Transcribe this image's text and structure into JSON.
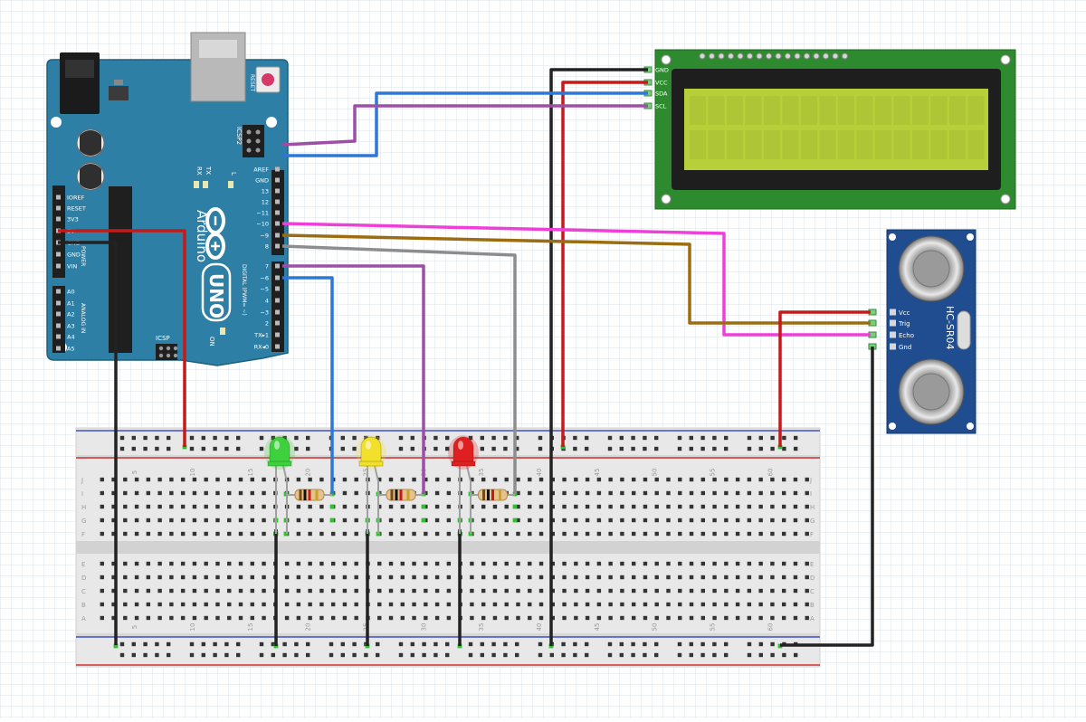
{
  "arduino": {
    "brand": "Arduino",
    "model": "UNO",
    "reset_label": "RESET",
    "icsp2_label": "ICSP2",
    "icsp_label": "ICSP",
    "tx_label": "TX",
    "rx_label": "RX",
    "l_label": "L",
    "on_label": "ON",
    "digital_label": "DIGITAL (PWM= ~)",
    "power_label": "POWER",
    "analog_label": "ANALOG IN",
    "digital_pins": [
      "AREF",
      "GND",
      "13",
      "12",
      "~11",
      "~10",
      "~9",
      "8",
      "7",
      "~6",
      "~5",
      "4",
      "~3",
      "2",
      "TX▸1",
      "RX◂0"
    ],
    "power_pins": [
      "IOREF",
      "RESET",
      "3V3",
      "5V",
      "GND",
      "GND",
      "VIN"
    ],
    "analog_pins": [
      "A0",
      "A1",
      "A2",
      "A3",
      "A4",
      "A5"
    ]
  },
  "lcd": {
    "pins": [
      "GND",
      "VCC",
      "SDA",
      "SCL"
    ]
  },
  "sensor": {
    "model": "HC-SR04",
    "pins": [
      "Vcc",
      "Trig",
      "Echo",
      "Gnd"
    ]
  },
  "breadboard": {
    "column_numbers": [
      "5",
      "10",
      "15",
      "20",
      "25",
      "30",
      "35",
      "40",
      "45",
      "50",
      "55",
      "60"
    ],
    "rows_top": [
      "J",
      "I",
      "H",
      "G",
      "F"
    ],
    "rows_bottom": [
      "E",
      "D",
      "C",
      "B",
      "A"
    ]
  },
  "leds": [
    {
      "name": "green",
      "color": "#3dd13d"
    },
    {
      "name": "yellow",
      "color": "#f2e02a"
    },
    {
      "name": "red",
      "color": "#e02020"
    }
  ],
  "colors": {
    "board": "#2e7fa5",
    "lcd_pcb": "#2e8a2e",
    "lcd_screen": "#b7d03a",
    "sensor": "#1f4d8f",
    "wire_red": "#c41a1a",
    "wire_black": "#222222",
    "wire_blue": "#2d78d6",
    "wire_purple": "#9d4fa8",
    "wire_magenta": "#ee3fd9",
    "wire_brown": "#9c6d10",
    "wire_gray": "#8d8d8d"
  }
}
